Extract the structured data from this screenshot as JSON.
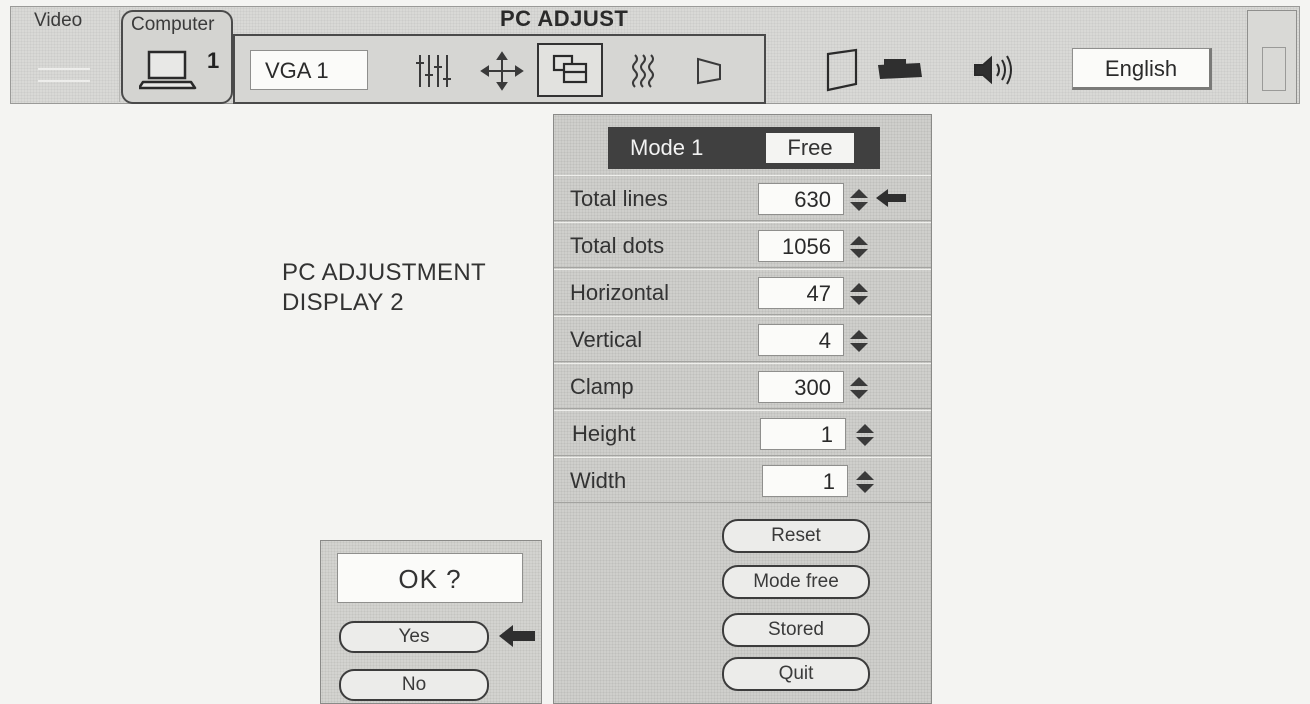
{
  "menubar": {
    "title": "PC ADJUST",
    "video_tab_label": "Video",
    "computer_tab_label": "Computer",
    "computer_number": "1",
    "source_value": "VGA 1",
    "language": "English"
  },
  "side_text": {
    "line1": "PC ADJUSTMENT",
    "line2": "DISPLAY 2"
  },
  "panel": {
    "mode_label": "Mode 1",
    "mode_value": "Free",
    "rows": [
      {
        "label": "Total lines",
        "value": "630"
      },
      {
        "label": "Total dots",
        "value": "1056"
      },
      {
        "label": "Horizontal",
        "value": "47"
      },
      {
        "label": "Vertical",
        "value": "4"
      },
      {
        "label": "Clamp",
        "value": "300"
      },
      {
        "label": "Height",
        "value": "1"
      },
      {
        "label": "Width",
        "value": "1"
      }
    ],
    "buttons": {
      "reset": "Reset",
      "mode_free": "Mode free",
      "stored": "Stored",
      "quit": "Quit"
    }
  },
  "dialog": {
    "prompt": "OK ?",
    "yes": "Yes",
    "no": "No"
  },
  "icons": {
    "video_tab": "video-input-icon",
    "computer_tab": "computer-monitor-icon",
    "pc_adjust": "pc-adjust-icon",
    "position": "position-arrows-icon",
    "pc_adjust_panel": "pc-adjust-panel-icon",
    "picture": "picture-adjust-icon",
    "screen": "screen-icon",
    "keystone": "keystone-icon",
    "projector": "projector-icon",
    "sound": "speaker-icon",
    "spinner": "up-down-spinner-icon",
    "pointer": "left-arrow-pointer-icon"
  }
}
